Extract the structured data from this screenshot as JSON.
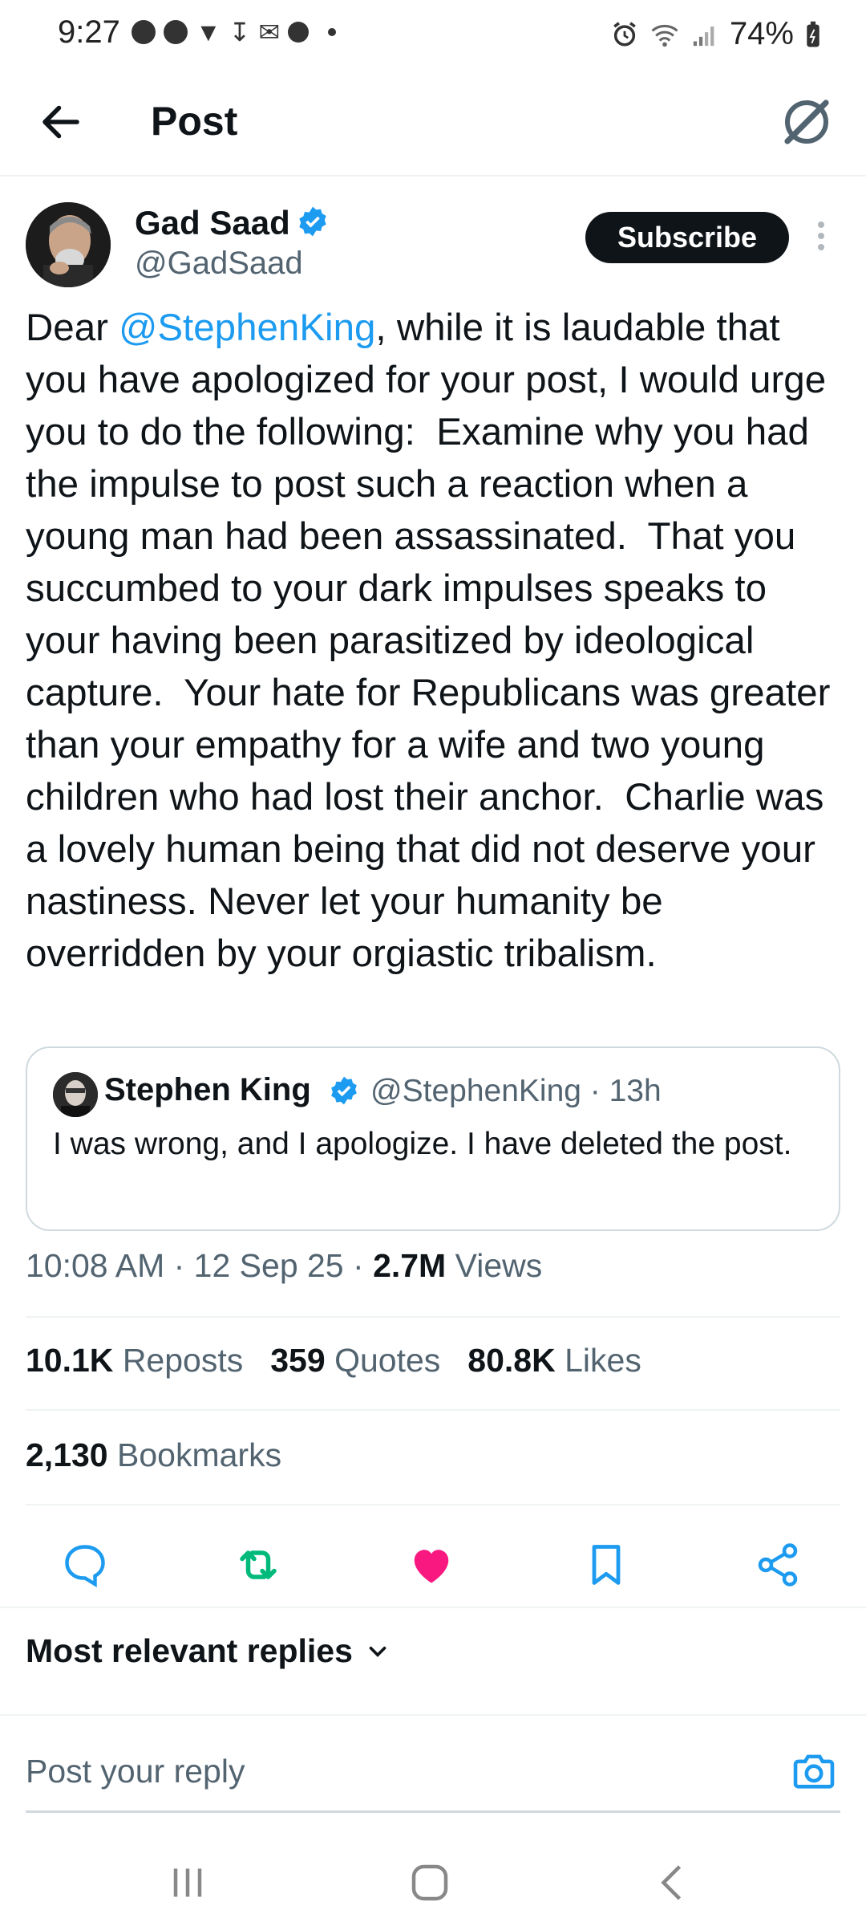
{
  "status_bar": {
    "time": "9:27",
    "battery": "74%"
  },
  "header": {
    "title": "Post"
  },
  "post": {
    "author_name": "Gad Saad",
    "author_handle": "@GadSaad",
    "subscribe_label": "Subscribe",
    "text_prefix": "Dear ",
    "mention": "@StephenKing",
    "text_body": ", while it is laudable that you have apologized for your post, I would urge you to do the following:  Examine why you had the impulse to post such a reaction when a young man had been assassinated.  That you succumbed to your dark impulses speaks to your having been parasitized by ideological capture.  Your hate for Republicans was greater than your empathy for a wife and two young children who had lost their anchor.  Charlie was a lovely human being that did not deserve your nastiness. Never let your humanity be overridden by your orgiastic tribalism.",
    "quoted": {
      "name": "Stephen King",
      "handle_time": "@StephenKing · 13h",
      "text": "I was wrong, and I apologize. I have deleted the post."
    },
    "time": "10:08 AM",
    "date": "12 Sep 25",
    "views_count": "2.7M",
    "views_label": "Views"
  },
  "stats": {
    "reposts_count": "10.1K",
    "reposts_label": "Reposts",
    "quotes_count": "359",
    "quotes_label": "Quotes",
    "likes_count": "80.8K",
    "likes_label": "Likes",
    "bookmarks_count": "2,130",
    "bookmarks_label": "Bookmarks"
  },
  "replies": {
    "sort_label": "Most relevant replies",
    "input_placeholder": "Post your reply"
  },
  "colors": {
    "accent": "#1d9bf0",
    "like": "#f91880",
    "repost": "#00ba7c",
    "text": "#0f1419",
    "muted": "#536471"
  },
  "icons": {
    "back": "back-arrow-icon",
    "grok": "grok-icon",
    "verified": "verified-badge-icon",
    "reply": "reply-icon",
    "repost": "repost-icon",
    "like": "heart-icon",
    "bookmark": "bookmark-icon",
    "share": "share-icon",
    "camera": "camera-icon"
  }
}
